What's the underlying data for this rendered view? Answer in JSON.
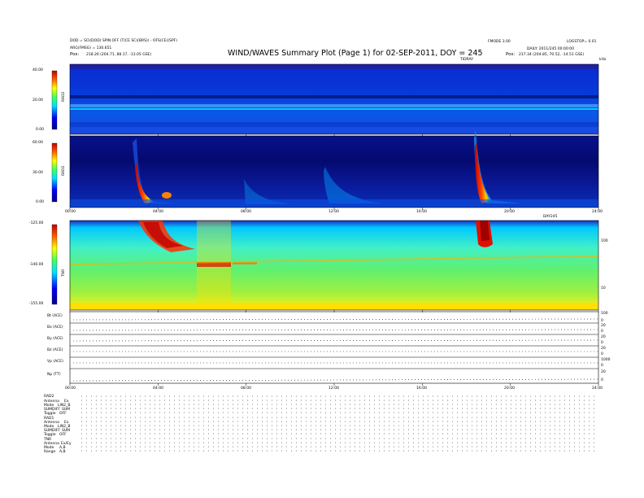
{
  "header": {
    "title": "WIND/WAVES Summary Plot (Page 1) for 02-SEP-2011, DOY = 245",
    "left_line1": "DOD = SCI(DOD) SPIN OFF (T(CE SC)(BRS)) - OFS(CE)(SPF)",
    "left_line2": "ARG(FMSG) = 130.651",
    "left_pos_label": "Pos:",
    "left_pos": "218.26 (204.71, 88.17, -13.05 GSE)",
    "center_right_code": "FMODE 3.00",
    "right_line1": "LOGSTOP= 0.01",
    "right_line2": "DAILY: 2011/245 00:00:00",
    "right_pos_label": "Pos:",
    "right_pos": "217.34 (204.85, 70.52, -14.51 GSE)",
    "right_small": "TIDRAY",
    "right_corner": "kHz"
  },
  "chart_data": [
    {
      "type": "heatmap",
      "panel": "RAD2",
      "ylabel": "RAD2",
      "yticks": [
        "40.00",
        "20.00",
        "0.00"
      ],
      "ylim": [
        0,
        40
      ]
    },
    {
      "type": "heatmap",
      "panel": "RAD1",
      "ylabel": "RAD1",
      "yticks": [
        "60.00",
        "30.00",
        "0.00"
      ],
      "ylim": [
        0,
        60
      ],
      "xticks": [
        "00:00",
        "04:00",
        "08:00",
        "12:00",
        "16:00",
        "20:00",
        "24:00"
      ],
      "xcorner": "DAY245"
    },
    {
      "type": "heatmap",
      "panel": "TNR",
      "ylabel": "TNR",
      "yticks": [
        "-125.00",
        "-140.00",
        "-155.00"
      ],
      "ylim": [
        -155,
        -125
      ],
      "right_ticks": [
        "100",
        "10"
      ]
    },
    {
      "type": "line",
      "panels": [
        {
          "label": "Bt (ACE)",
          "right": [
            "100",
            "0"
          ]
        },
        {
          "label": "Bx (ACE)",
          "right": [
            "20",
            "0"
          ]
        },
        {
          "label": "By (ACE)",
          "right": [
            "20",
            "0"
          ]
        },
        {
          "label": "Bz (ACE)",
          "right": [
            "20",
            "0"
          ]
        },
        {
          "label": "Vp (ACE)",
          "right": [
            "1000",
            "0"
          ]
        },
        {
          "label": "Np (TT)",
          "right": [
            "20",
            "0"
          ]
        }
      ],
      "xticks": [
        "00:00",
        "04:00",
        "08:00",
        "12:00",
        "16:00",
        "20:00",
        "24:00"
      ]
    }
  ],
  "status_blocks": [
    {
      "name": "RAD2",
      "rows": [
        [
          "Antenna",
          "Ex"
        ],
        [
          "Mode",
          "LIN2_B"
        ],
        [
          "SUMDIFF",
          "SUM"
        ],
        [
          "Toggle",
          "OFF"
        ]
      ]
    },
    {
      "name": "RAD1",
      "rows": [
        [
          "Antenna",
          "Ex"
        ],
        [
          "Mode",
          "LIN2_B"
        ],
        [
          "SUMDIFF",
          "SUM"
        ],
        [
          "Toggle",
          "OFF"
        ]
      ]
    },
    {
      "name": "TNR",
      "rows": [
        [
          "Antenna",
          "Ex/Ey"
        ],
        [
          "Mode",
          "A,B"
        ],
        [
          "Range",
          "A,B"
        ]
      ]
    }
  ]
}
